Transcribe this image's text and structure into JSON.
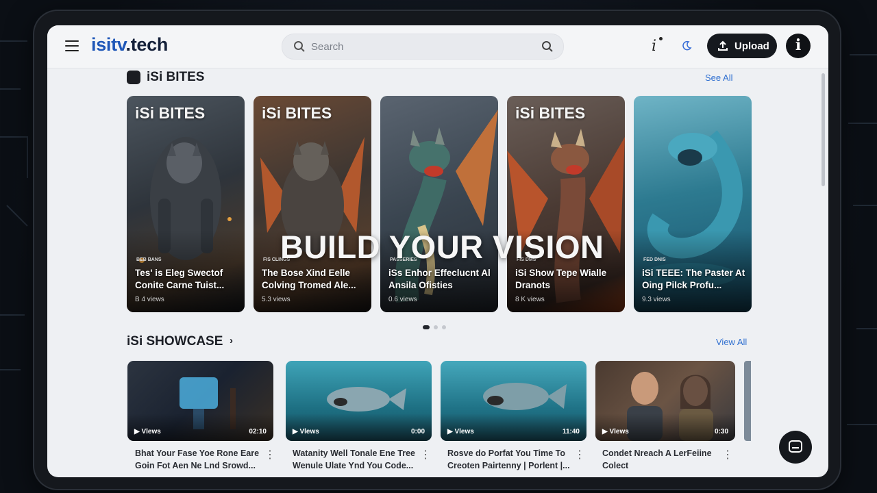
{
  "header": {
    "logo_prefix": "isitv",
    "logo_suffix": ".tech",
    "search_placeholder": "Search",
    "info_glyph": "i",
    "upload_label": "Upload"
  },
  "bites": {
    "title": "iSi BITES",
    "see_all": "See All",
    "overlay": "BUILD YOUR VISION",
    "cards": [
      {
        "brand": "iSi BITES",
        "tag": "BEB BANS",
        "title": "Tes' is Eleg Swectof Conite Carne Tuist...",
        "views": "B 4 views"
      },
      {
        "brand": "iSi BITES",
        "tag": "FIS CLINGS",
        "title": "The Bose Xind Eelle Colving Tromed Ale...",
        "views": "5.3 views"
      },
      {
        "brand": "",
        "tag": "PASSERIES",
        "title": "iSs Enhor Effeclucnt Al Ansila Ofisties",
        "views": "0.6 views"
      },
      {
        "brand": "iSi BITES",
        "tag": "FIS DMS",
        "title": "iSi Show Tepe Wialle Dranots",
        "views": "8 K views"
      },
      {
        "brand": "",
        "tag": "FED DNIS",
        "title": "iSi TEEE: The Paster At Oing Pilck Profu...",
        "views": "9.3 views"
      }
    ]
  },
  "showcase": {
    "title": "iSi SHOWCASE",
    "chevron": "›",
    "view_all": "View All",
    "videos": [
      {
        "badge": "Vlews",
        "duration": "02:10",
        "title": "Bhat Your Fase Yoe Rone Eare Goin Fot Aen Ne Lnd Srowd..."
      },
      {
        "badge": "Vlews",
        "duration": "0:00",
        "title": "Watanity Well Tonale Ene Tree Wenule Ulate Ynd You Code..."
      },
      {
        "badge": "Vlews",
        "duration": "11:40",
        "title": "Rosve do Porfat You Time To Creoten Pairtenny | Porlent |..."
      },
      {
        "badge": "Vlews",
        "duration": "0:30",
        "title": "Condet Nreach A LerFeiine Colect"
      }
    ]
  },
  "colors": {
    "accent_blue": "#1f57b8",
    "link_blue": "#2f6fd0",
    "dark_button": "#16191f",
    "page_bg": "#eef0f3"
  },
  "icons": {
    "menu": "hamburger-icon",
    "search": "search-icon",
    "theme": "moon-icon",
    "upload": "upload-icon",
    "profile": "info-avatar-icon",
    "chat": "chat-icon",
    "play": "play-icon"
  }
}
